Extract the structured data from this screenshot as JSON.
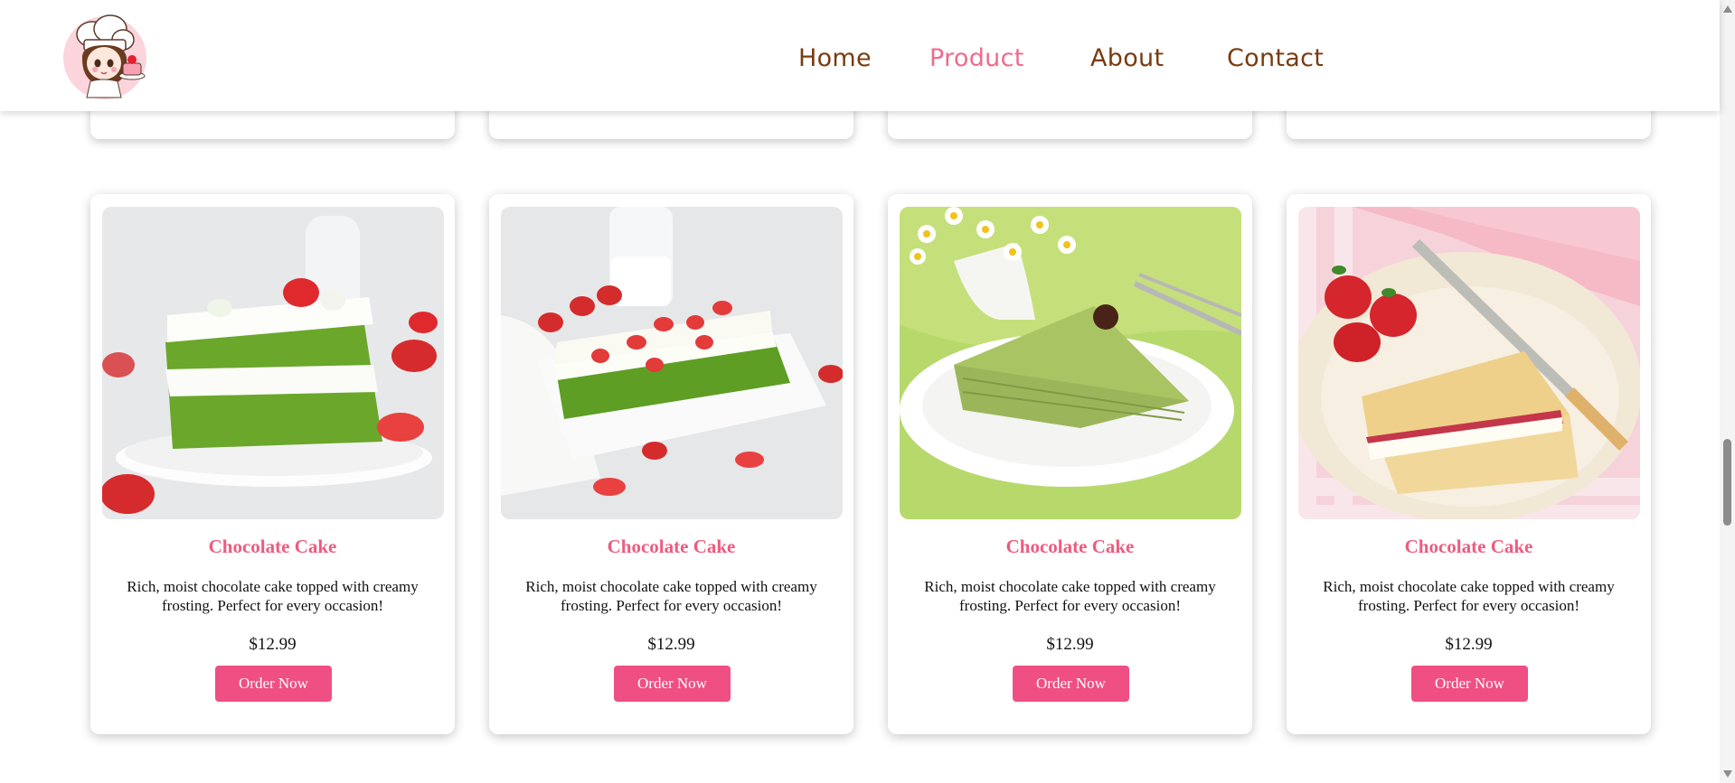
{
  "nav": {
    "items": [
      {
        "label": "Home",
        "active": false
      },
      {
        "label": "Product",
        "active": true
      },
      {
        "label": "About",
        "active": false
      },
      {
        "label": "Contact",
        "active": false
      }
    ]
  },
  "colors": {
    "accent_pink": "#ef4f82",
    "title_pink": "#ee5b7f",
    "nav_brown": "#7a3b10",
    "nav_active": "#ee6b8c"
  },
  "logo": {
    "icon": "chef-girl-logo-icon"
  },
  "products": [
    {
      "image": "matcha-layer-cake-strawberries",
      "title": "Chocolate Cake",
      "description": "Rich, moist chocolate cake topped with creamy frosting. Perfect for every occasion!",
      "price": "$12.99",
      "button": "Order Now"
    },
    {
      "image": "matcha-sheet-cake-strawberries",
      "title": "Chocolate Cake",
      "description": "Rich, moist chocolate cake topped with creamy frosting. Perfect for every occasion!",
      "price": "$12.99",
      "button": "Order Now"
    },
    {
      "image": "matcha-crepe-cake-slice",
      "title": "Chocolate Cake",
      "description": "Rich, moist chocolate cake topped with creamy frosting. Perfect for every occasion!",
      "price": "$12.99",
      "button": "Order Now"
    },
    {
      "image": "victoria-sponge-strawberries",
      "title": "Chocolate Cake",
      "description": "Rich, moist chocolate cake topped with creamy frosting. Perfect for every occasion!",
      "price": "$12.99",
      "button": "Order Now"
    }
  ]
}
